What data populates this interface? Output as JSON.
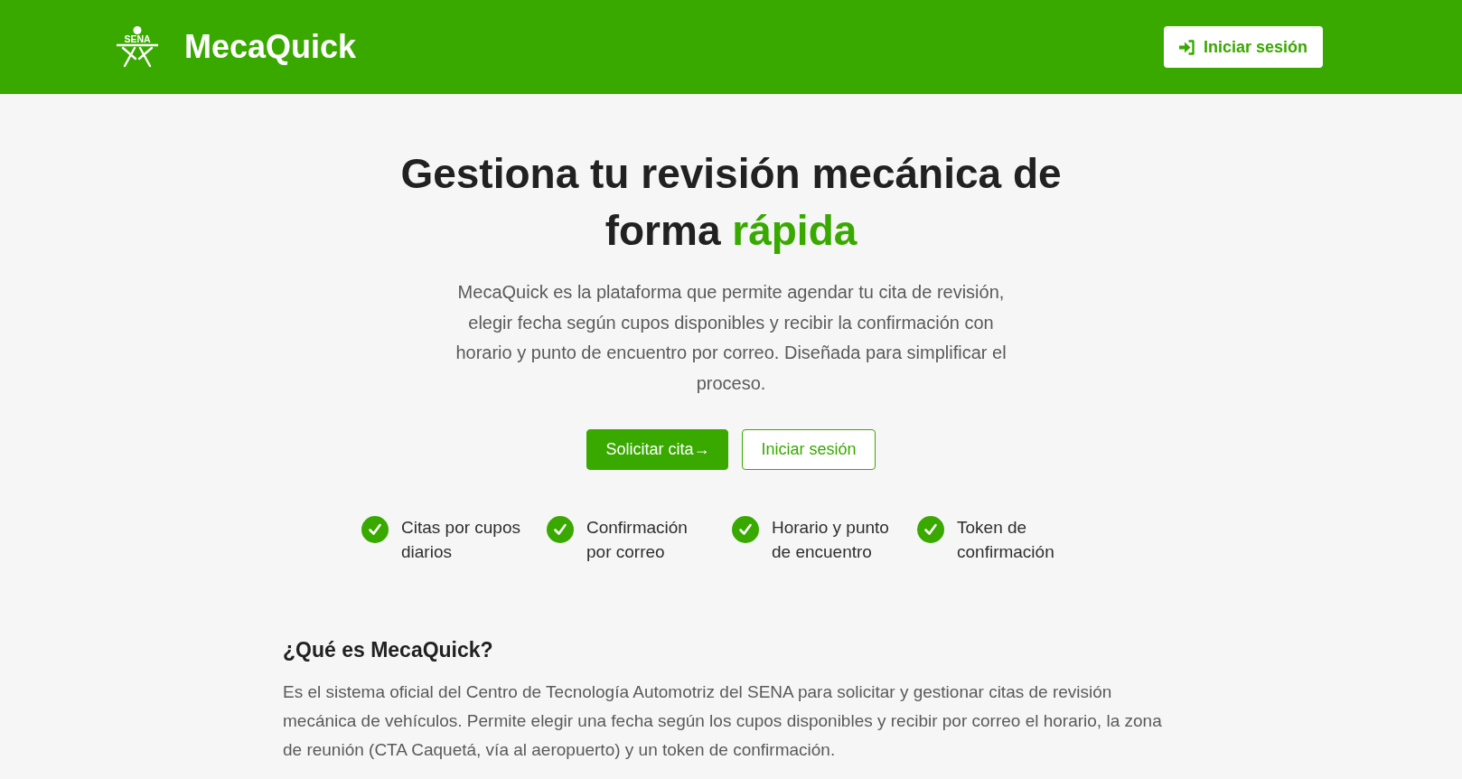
{
  "header": {
    "logo_text": "SENA",
    "brand": "MecaQuick",
    "login_button": "Iniciar sesión"
  },
  "hero": {
    "title": "Gestiona tu revisión mecánica de forma",
    "title_highlight": "rápida",
    "description": "MecaQuick es la plataforma que permite agendar tu cita de revisión, elegir fecha según cupos disponibles y recibir la confirmación con horario y punto de encuentro por correo. Diseñada para simplificar el proceso.",
    "buttons": [
      {
        "label": "Solicitar cita→",
        "kind": "primary"
      },
      {
        "label": "Iniciar sesión",
        "kind": "outline"
      }
    ],
    "features": [
      "Citas por cupos diarios",
      "Confirmación por correo",
      "Horario y punto de encuentro",
      "Token de confirmación"
    ]
  },
  "about": {
    "title": "¿Qué es MecaQuick?",
    "text": "Es el sistema oficial del Centro de Tecnología Automotriz del SENA para solicitar y gestionar citas de revisión mecánica de vehículos. Permite elegir una fecha según los cupos disponibles y recibir por correo el horario, la zona de reunión (CTA Caquetá, vía al aeropuerto) y un token de confirmación."
  }
}
